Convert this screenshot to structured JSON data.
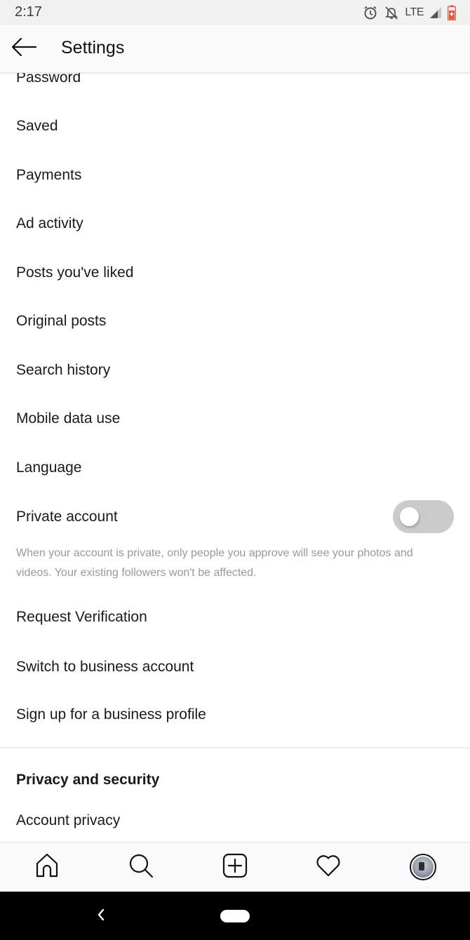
{
  "status_bar": {
    "time": "2:17",
    "network": "LTE",
    "icons": [
      "alarm-icon",
      "notifications-off-icon",
      "signal-icon",
      "battery-charging-icon"
    ],
    "battery_color": "#e8563a"
  },
  "header": {
    "back_icon": "arrow-left-icon",
    "title": "Settings"
  },
  "menu": {
    "items": [
      {
        "label": "Password"
      },
      {
        "label": "Saved"
      },
      {
        "label": "Payments"
      },
      {
        "label": "Ad activity"
      },
      {
        "label": "Posts you've liked"
      },
      {
        "label": "Original posts"
      },
      {
        "label": "Search history"
      },
      {
        "label": "Mobile data use"
      },
      {
        "label": "Language"
      }
    ],
    "private_account": {
      "label": "Private account",
      "enabled": false,
      "help": "When your account is private, only people you approve will see your photos and videos. Your existing followers won't be affected."
    },
    "more_items": [
      {
        "label": "Request Verification"
      },
      {
        "label": "Switch to business account"
      },
      {
        "label": "Sign up for a business profile"
      }
    ]
  },
  "privacy_section": {
    "title": "Privacy and security",
    "items": [
      {
        "label": "Account privacy"
      }
    ]
  },
  "tab_bar": {
    "tabs": [
      {
        "name": "home",
        "icon": "home-icon"
      },
      {
        "name": "search",
        "icon": "search-icon"
      },
      {
        "name": "new-post",
        "icon": "plus-square-icon"
      },
      {
        "name": "activity",
        "icon": "heart-icon"
      },
      {
        "name": "profile",
        "icon": "avatar"
      }
    ]
  },
  "nav_bar": {
    "back_icon": "chevron-left-icon",
    "home_icon": "home-pill-icon"
  }
}
